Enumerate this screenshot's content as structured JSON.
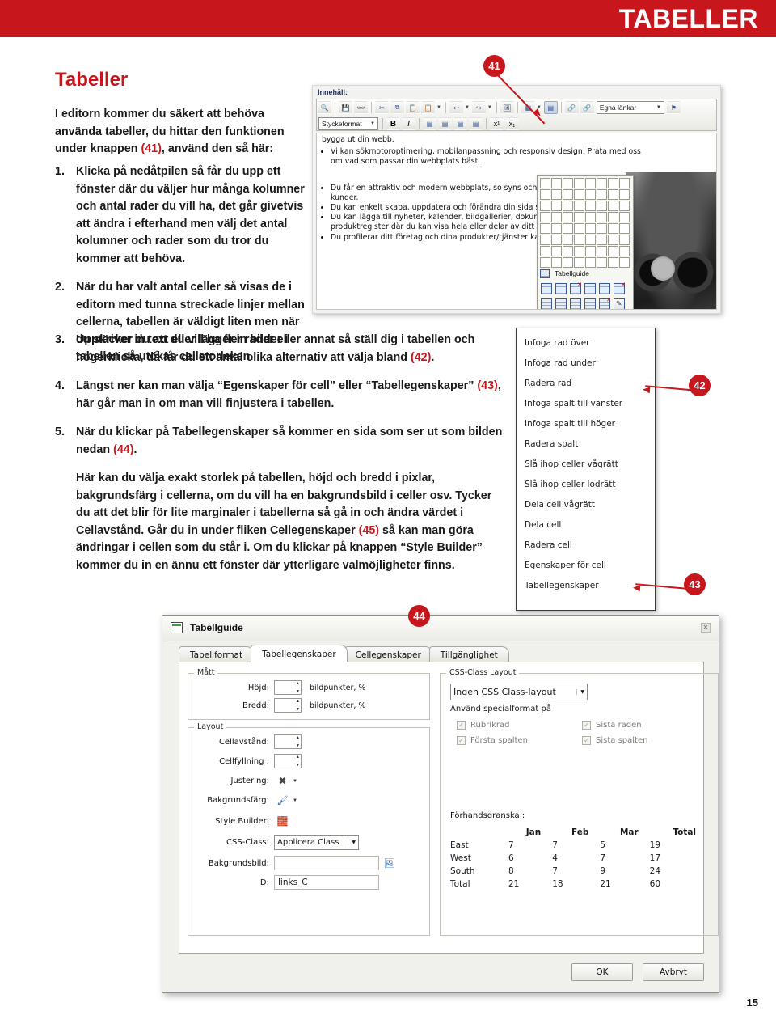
{
  "header": {
    "title": "TABELLER"
  },
  "page": {
    "heading": "Tabeller",
    "number": "15",
    "accent_color": "#c8161d"
  },
  "intro": {
    "line1": "I editorn kommer du säkert att behöva",
    "line2": "använda tabeller, du hittar den funktionen",
    "line3_a": "under knappen ",
    "line3_ref": "(41)",
    "line3_b": ", använd den så här:"
  },
  "steps": [
    {
      "num": "1.",
      "text": "Klicka på nedåtpilen så får du upp ett fönster där du väljer hur många kolumner och antal rader du vill ha, det går givetvis att ändra i efterhand men välj det antal kolumner och rader som du tror du kommer att behöva."
    },
    {
      "num": "2.",
      "text": "När du har valt antal celler så visas de i editorn med tunna streckade linjer mellan cellerna, tabellen är väldigt liten men när du skriver in text eller lägger in bilder i tabellen så utökas cellstorleken."
    },
    {
      "num": "3.",
      "text_a": "Upptäcker du att du vill ha fler rader eller annat så ställ dig i tabellen och högerklicka, då får du ett antal olika alternativ att välja bland ",
      "ref": "(42)",
      "text_b": "."
    },
    {
      "num": "4.",
      "text_a": "Längst ner kan man välja ",
      "bold1": "“Egenskaper för cell”",
      "text_mid": " eller ",
      "bold2": "“Tabellegenskaper”",
      "ref": "(43)",
      "text_b": ", här går man in om man vill finjustera i tabellen."
    },
    {
      "num": "5.",
      "text_a": "När du klickar på ",
      "bold1": "Tabellegenskaper",
      "text_mid": " så kommer en sida som ser ut som bilden nedan ",
      "ref": "(44)",
      "text_b": "."
    }
  ],
  "closing": {
    "a": "Här kan du välja exakt storlek på tabellen, höjd och bredd i pixlar, bakgrundsfärg i cellerna, om du vill ha en bakgrundsbild i celler osv. Tycker du att det blir för lite marginaler i tabellerna så gå in och ändra värdet i ",
    "bold1": "Cellavstånd.",
    "b": " Går du in under fliken ",
    "bold2": "Cellegenskaper",
    "ref": "(45)",
    "c": " så kan man göra ändringar i cellen som du står i. Om du klickar på knappen “Style Builder” kommer du in en ännu ett fönster där ytterligare valmöjligheter finns."
  },
  "editor": {
    "content_label": "Innehåll:",
    "toolbar_row1_icons": [
      "preview-icon",
      "save-icon",
      "find-icon",
      "cut-icon",
      "copy-icon",
      "paste-icon",
      "paste-special-icon",
      "undo-icon",
      "redo-icon",
      "insert-image-icon",
      "insert-table-icon",
      "table-properties-icon",
      "insert-link-icon",
      "remove-link-icon"
    ],
    "toolbar_row2_icons": [
      "bold-icon",
      "italic-icon",
      "align-left-icon",
      "align-center-icon",
      "align-right-icon",
      "justify-icon",
      "superscript-icon",
      "subscript-icon"
    ],
    "style_select": "Styckeformat",
    "links_select": "Egna länkar",
    "anchor_icon": "anchor-icon",
    "body_lines": [
      "bygga ut din webb."
    ],
    "bullets_1": [
      "Vi kan sökmotoroptimering, mobilanpassning och responsiv design. Prata med oss om vad som passar din webbplats bäst."
    ],
    "bullets_2": [
      "Du får en attraktiv och modern webbplats, so syns och lätt kan hittas av dina kunder.",
      "Du kan enkelt skapa, uppdatera och förändra din sida själv.",
      "Du kan lägga till nyheter, kalender, bildgallerier, dokument- och bildarkiv samt produktregister där du kan visa hela eller delar av ditt sortiment.",
      "Du profilerar ditt företag och dina produkter/tjänster kan hittas på nätet."
    ],
    "tablegrid": {
      "cols": 8,
      "rows": 8,
      "label": "Tabellguide"
    }
  },
  "context_menu": {
    "items": [
      "Infoga rad över",
      "Infoga rad under",
      "Radera rad",
      "Infoga spalt till vänster",
      "Infoga spalt till höger",
      "Radera spalt",
      "Slå ihop celler vågrätt",
      "Slå ihop celler lodrätt",
      "Dela cell vågrätt",
      "Dela cell",
      "Radera cell",
      "Egenskaper för cell",
      "Tabellegenskaper"
    ]
  },
  "dialog": {
    "title": "Tabellguide",
    "close_icon": "close-icon",
    "tabs": [
      {
        "label": "Tabellformat",
        "active": false
      },
      {
        "label": "Tabellegenskaper",
        "active": true
      },
      {
        "label": "Cellegenskaper",
        "active": false
      },
      {
        "label": "Tillgänglighet",
        "active": false
      }
    ],
    "matt": {
      "legend": "Mått",
      "hojd_label": "Höjd:",
      "hojd_value": "",
      "hojd_unit": "bildpunkter, %",
      "bredd_label": "Bredd:",
      "bredd_value": "",
      "bredd_unit": "bildpunkter, %"
    },
    "layout": {
      "legend": "Layout",
      "cellavstand_label": "Cellavstånd:",
      "cellavstand_value": "",
      "cellfyllning_label": "Cellfyllning :",
      "cellfyllning_value": "",
      "justering_label": "Justering:",
      "justering_icon": "align-none-icon",
      "bakgrundsfarg_label": "Bakgrundsfärg:",
      "bakgrundsfarg_icon": "paint-bucket-icon",
      "stylebuilder_label": "Style Builder:",
      "stylebuilder_icon": "style-builder-icon",
      "cssclass_label": "CSS-Class:",
      "cssclass_value": "Applicera Class",
      "bakgrundsbild_label": "Bakgrundsbild:",
      "bakgrundsbild_value": "",
      "bakgrundsbild_browse_icon": "browse-image-icon",
      "id_label": "ID:",
      "id_value": "links_C"
    },
    "css": {
      "legend": "CSS-Class Layout",
      "select_value": "Ingen CSS Class-layout",
      "special_label": "Använd specialformat på",
      "checkboxes": [
        {
          "label": "Rubrikrad",
          "checked": true
        },
        {
          "label": "Sista raden",
          "checked": true
        },
        {
          "label": "Första spalten",
          "checked": true
        },
        {
          "label": "Sista spalten",
          "checked": true
        }
      ],
      "preview_label": "Förhandsgranska :"
    },
    "buttons": {
      "ok": "OK",
      "cancel": "Avbryt"
    }
  },
  "chart_data": {
    "type": "table",
    "title": "Förhandsgranska :",
    "columns": [
      "",
      "Jan",
      "Feb",
      "Mar",
      "Total"
    ],
    "rows": [
      {
        "label": "East",
        "values": [
          7,
          7,
          5,
          19
        ]
      },
      {
        "label": "West",
        "values": [
          6,
          4,
          7,
          17
        ]
      },
      {
        "label": "South",
        "values": [
          8,
          7,
          9,
          24
        ]
      },
      {
        "label": "Total",
        "values": [
          21,
          18,
          21,
          60
        ]
      }
    ]
  },
  "callouts": [
    {
      "id": "41",
      "label": "41"
    },
    {
      "id": "42",
      "label": "42"
    },
    {
      "id": "43",
      "label": "43"
    },
    {
      "id": "44",
      "label": "44"
    }
  ]
}
